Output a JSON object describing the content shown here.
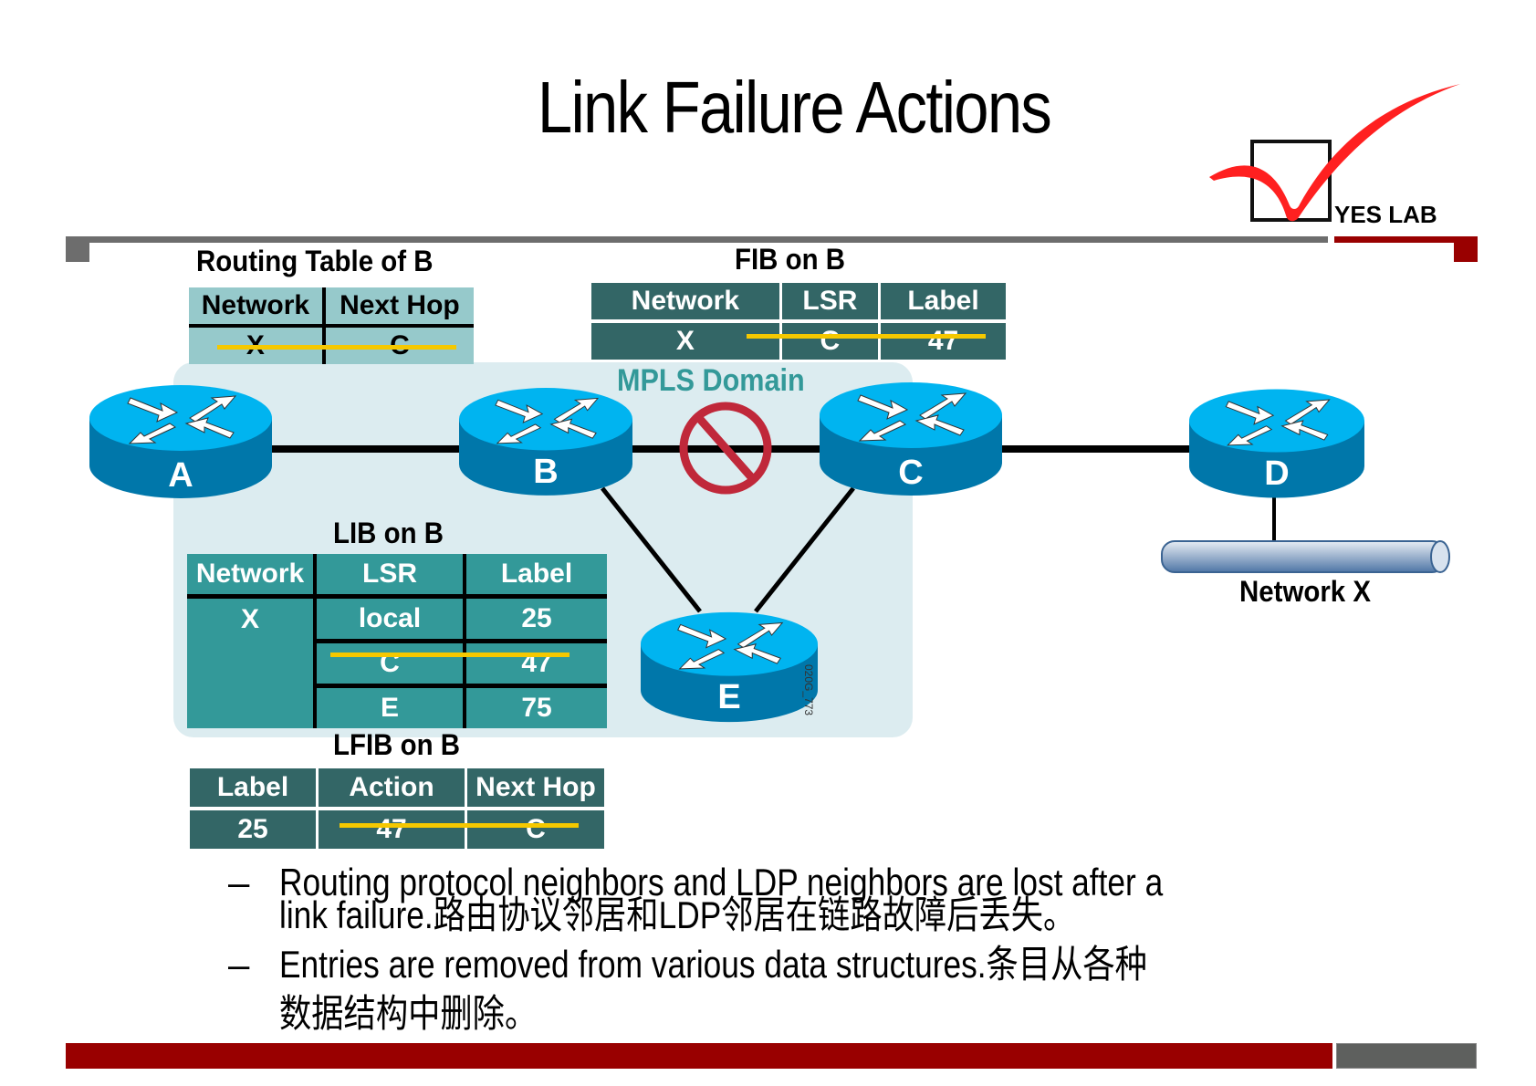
{
  "slide": {
    "title": "Link Failure Actions",
    "logo_text": "YES LAB",
    "figure_id": "020G_773"
  },
  "colors": {
    "accent_red": "#990000",
    "rule_gray": "#6d6d6d",
    "strike_yellow": "#f5c800",
    "router_top": "#00b4f0",
    "router_body": "#0077aa",
    "table_dark_teal": "#336666",
    "table_teal": "#339999",
    "table_light_teal": "#96c9cb",
    "mpls_panel": "#dcecf0",
    "no_symbol_red": "#c0283a"
  },
  "routing_table": {
    "title": "Routing Table of B",
    "headers": [
      "Network",
      "Next Hop"
    ],
    "rows": [
      {
        "network": "X",
        "next_hop": "C",
        "struck": true
      }
    ]
  },
  "fib": {
    "title": "FIB on B",
    "headers": [
      "Network",
      "LSR",
      "Label"
    ],
    "rows": [
      {
        "network": "X",
        "lsr": "C",
        "label": "47",
        "struck": true
      }
    ]
  },
  "mpls_domain_label": "MPLS Domain",
  "routers": [
    {
      "name": "A"
    },
    {
      "name": "B"
    },
    {
      "name": "C"
    },
    {
      "name": "D"
    },
    {
      "name": "E"
    }
  ],
  "links": [
    {
      "from": "A",
      "to": "B",
      "status": "up"
    },
    {
      "from": "B",
      "to": "C",
      "status": "failed"
    },
    {
      "from": "C",
      "to": "D",
      "status": "up"
    },
    {
      "from": "B",
      "to": "E",
      "status": "up"
    },
    {
      "from": "C",
      "to": "E",
      "status": "up"
    },
    {
      "from": "D",
      "to": "Network X",
      "status": "up"
    }
  ],
  "network_x_label": "Network X",
  "lib": {
    "title": "LIB on B",
    "headers": [
      "Network",
      "LSR",
      "Label"
    ],
    "network": "X",
    "rows": [
      {
        "lsr": "local",
        "label": "25",
        "struck": false
      },
      {
        "lsr": "C",
        "label": "47",
        "struck": true
      },
      {
        "lsr": "E",
        "label": "75",
        "struck": false
      }
    ]
  },
  "lfib": {
    "title": "LFIB on B",
    "headers": [
      "Label",
      "Action",
      "Next Hop"
    ],
    "rows": [
      {
        "label": "25",
        "action": "47",
        "next_hop": "C",
        "struck": true
      }
    ]
  },
  "bullets": [
    {
      "dash": "–",
      "line1": "Routing protocol neighbors and LDP neighbors are lost after a",
      "line2": "link failure.路由协议邻居和LDP邻居在链路故障后丢失。"
    },
    {
      "dash": "–",
      "line1": "Entries are removed from various data structures.条目从各种",
      "line2": "数据结构中删除。"
    }
  ]
}
